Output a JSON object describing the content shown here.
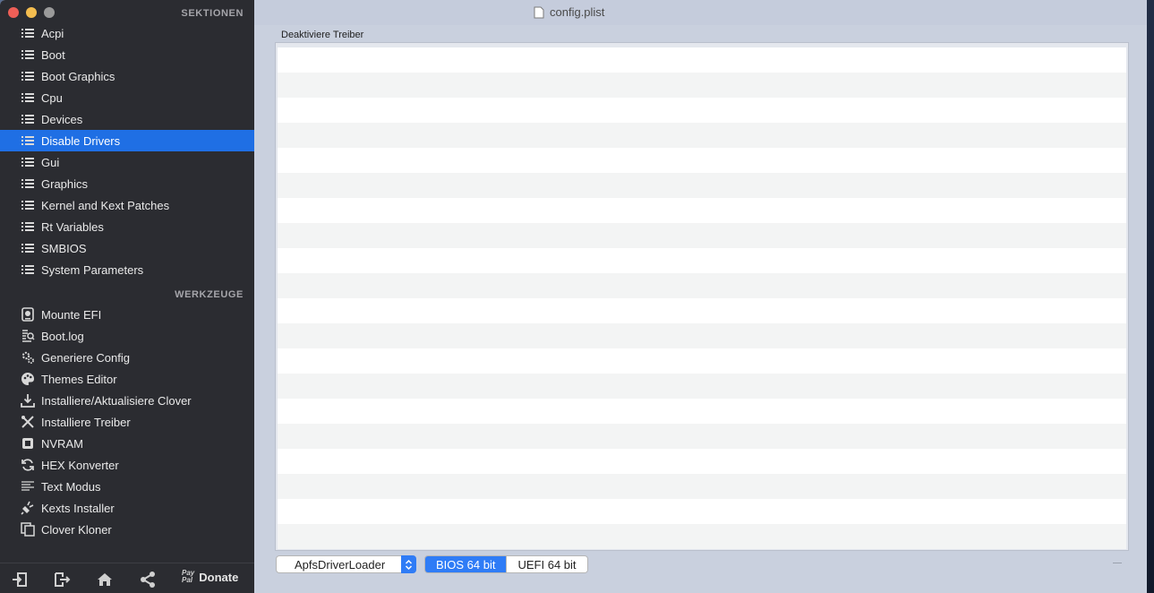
{
  "window": {
    "title": "config.plist"
  },
  "sidebar": {
    "sections_header": "SEKTIONEN",
    "sections": [
      {
        "label": "Acpi",
        "name": "sidebar-item-acpi",
        "selected": false
      },
      {
        "label": "Boot",
        "name": "sidebar-item-boot",
        "selected": false
      },
      {
        "label": "Boot Graphics",
        "name": "sidebar-item-boot-graphics",
        "selected": false
      },
      {
        "label": "Cpu",
        "name": "sidebar-item-cpu",
        "selected": false
      },
      {
        "label": "Devices",
        "name": "sidebar-item-devices",
        "selected": false
      },
      {
        "label": "Disable Drivers",
        "name": "sidebar-item-disable-drivers",
        "selected": true
      },
      {
        "label": "Gui",
        "name": "sidebar-item-gui",
        "selected": false
      },
      {
        "label": "Graphics",
        "name": "sidebar-item-graphics",
        "selected": false
      },
      {
        "label": "Kernel and Kext Patches",
        "name": "sidebar-item-kernel-and-kext-patches",
        "selected": false
      },
      {
        "label": "Rt Variables",
        "name": "sidebar-item-rt-variables",
        "selected": false
      },
      {
        "label": "SMBIOS",
        "name": "sidebar-item-smbios",
        "selected": false
      },
      {
        "label": "System Parameters",
        "name": "sidebar-item-system-parameters",
        "selected": false
      }
    ],
    "tools_header": "WERKZEUGE",
    "tools": [
      {
        "label": "Mounte EFI",
        "name": "tool-mount-efi",
        "icon": "disk-icon"
      },
      {
        "label": "Boot.log",
        "name": "tool-boot-log",
        "icon": "log-search-icon"
      },
      {
        "label": "Generiere Config",
        "name": "tool-generate-config",
        "icon": "gears-icon"
      },
      {
        "label": "Themes Editor",
        "name": "tool-themes-editor",
        "icon": "palette-icon"
      },
      {
        "label": "Installiere/Aktualisiere Clover",
        "name": "tool-install-clover",
        "icon": "download-icon"
      },
      {
        "label": "Installiere Treiber",
        "name": "tool-install-drivers",
        "icon": "tools-icon"
      },
      {
        "label": "NVRAM",
        "name": "tool-nvram",
        "icon": "chip-icon"
      },
      {
        "label": "HEX Konverter",
        "name": "tool-hex-converter",
        "icon": "refresh-icon"
      },
      {
        "label": "Text Modus",
        "name": "tool-text-mode",
        "icon": "text-lines-icon"
      },
      {
        "label": "Kexts Installer",
        "name": "tool-kexts-installer",
        "icon": "plug-icon"
      },
      {
        "label": "Clover Kloner",
        "name": "tool-clover-cloner",
        "icon": "copy-icon"
      }
    ],
    "bottom": {
      "icons": [
        "import-icon",
        "export-icon",
        "home-icon",
        "share-icon"
      ],
      "paypal_line1": "Pay",
      "paypal_line2": "Pal",
      "donate_label": "Donate"
    }
  },
  "main": {
    "group_label": "Deaktiviere Treiber",
    "rows_count_visible": 20,
    "driver_popup": {
      "value": "ApfsDriverLoader"
    },
    "segmented": {
      "left": "BIOS 64 bit",
      "right": "UEFI 64 bit",
      "selected": "left"
    }
  },
  "colors": {
    "accent": "#1f6fe4",
    "sidebar_bg": "#2b2c31",
    "content_bg": "#c9d0de"
  }
}
